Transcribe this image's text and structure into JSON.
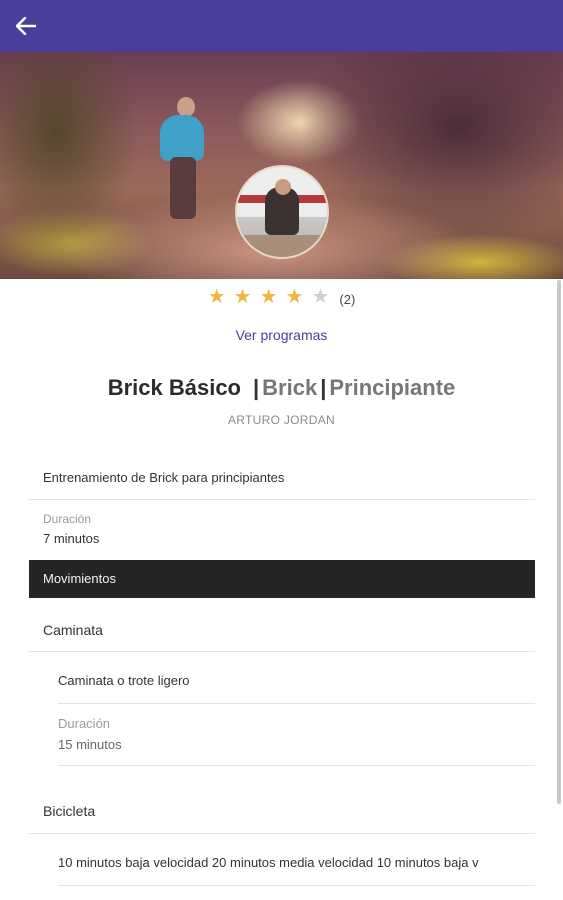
{
  "appbar": {
    "back_icon": "arrow-left-icon",
    "color": "#4a3e9b"
  },
  "rating": {
    "value": 4,
    "max": 5,
    "count_text": "(2)",
    "star_color": "#f2b540"
  },
  "link": {
    "ver_programas": "Ver programas"
  },
  "title": {
    "name": "Brick Básico",
    "sep": "|",
    "category": "Brick",
    "sep2": "|",
    "level": "Principiante"
  },
  "author": "ARTURO JORDAN",
  "description": "Entrenamiento de Brick para principiantes",
  "duration": {
    "label": "Duración",
    "value": "7 minutos"
  },
  "movements_header": "Movimientos",
  "movements": [
    {
      "name": "Caminata",
      "description": "Caminata o trote ligero",
      "duration_label": "Duración",
      "duration_value": "15 minutos"
    },
    {
      "name": "Bicicleta",
      "description": "10 minutos baja velocidad 20 minutos media velocidad 10 minutos baja v"
    }
  ]
}
